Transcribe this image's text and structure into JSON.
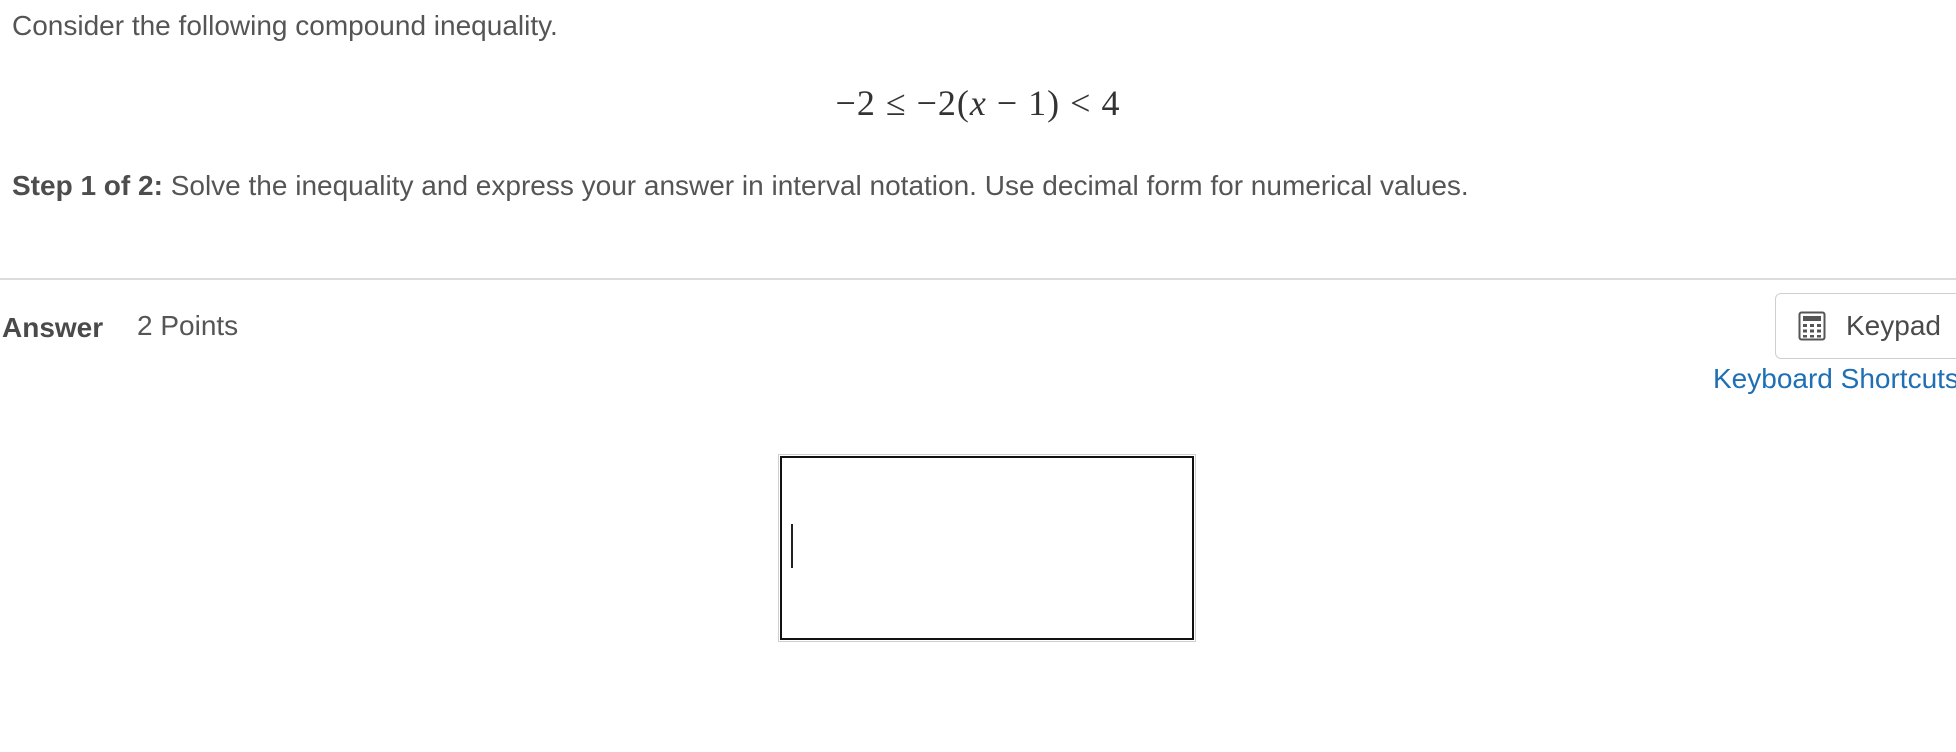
{
  "question": {
    "intro": "Consider the following compound inequality.",
    "equation": {
      "part1": "−2 ≤ −2(",
      "variable": "x",
      "part2": " − 1) < 4"
    },
    "step_label": "Step 1 of 2:",
    "step_text": " Solve the inequality and express your answer in interval notation. Use decimal form for numerical values."
  },
  "answer": {
    "label": "Answer",
    "points": "2 Points",
    "keypad_label": "Keypad",
    "keyboard_shortcuts_label": "Keyboard Shortcuts",
    "input_value": ""
  },
  "icons": {
    "keypad": "calculator-icon"
  },
  "colors": {
    "link": "#1f6fb5",
    "text": "#555555",
    "divider": "#dcdcdc"
  }
}
